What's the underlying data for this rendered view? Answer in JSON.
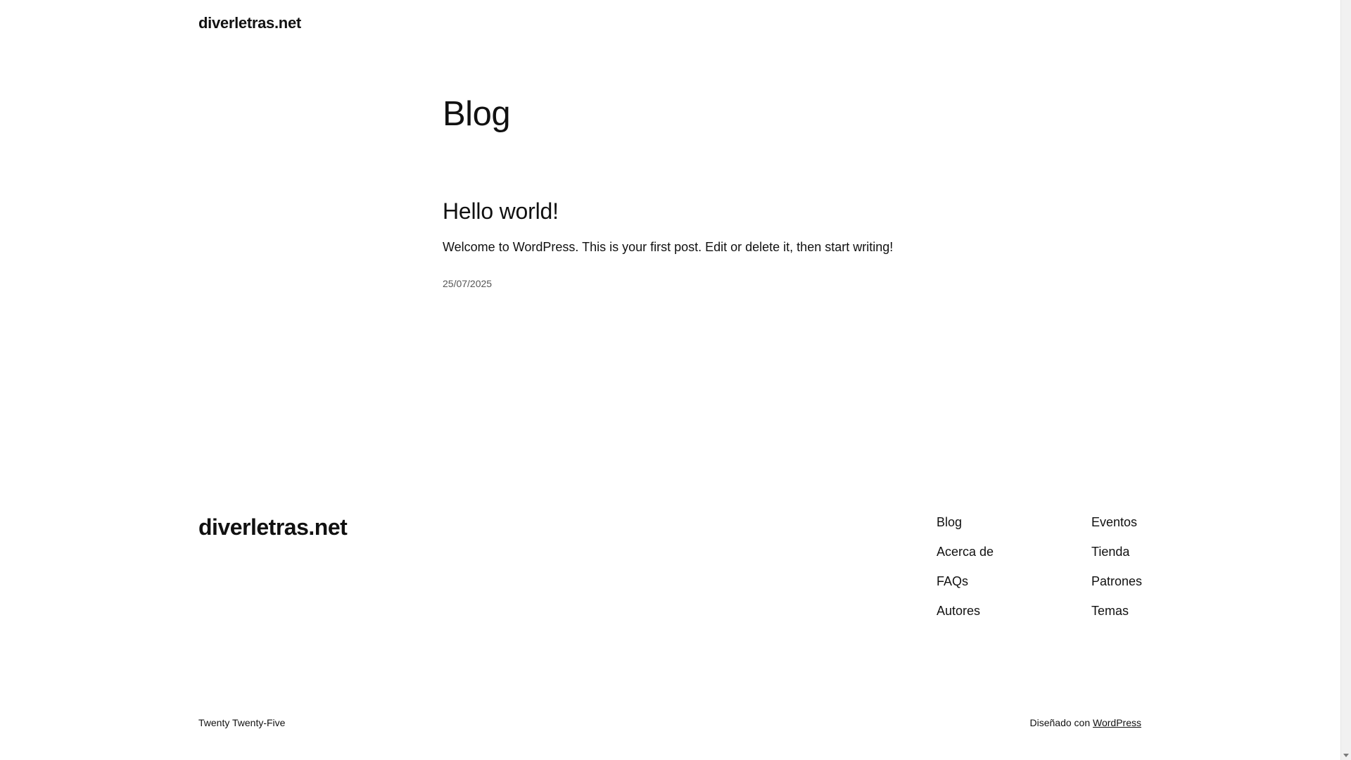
{
  "header": {
    "site_title": "diverletras.net"
  },
  "main": {
    "heading": "Blog",
    "post": {
      "title": "Hello world!",
      "excerpt": "Welcome to WordPress. This is your first post. Edit or delete it, then start writing!",
      "date": "25/07/2025"
    }
  },
  "footer": {
    "site_title": "diverletras.net",
    "nav_col1": [
      "Blog",
      "Acerca de",
      "FAQs",
      "Autores"
    ],
    "nav_col2": [
      "Eventos",
      "Tienda",
      "Patrones",
      "Temas"
    ],
    "theme_credit": "Twenty Twenty-Five",
    "designed_with": "Diseñado con",
    "wordpress_link": "WordPress"
  }
}
